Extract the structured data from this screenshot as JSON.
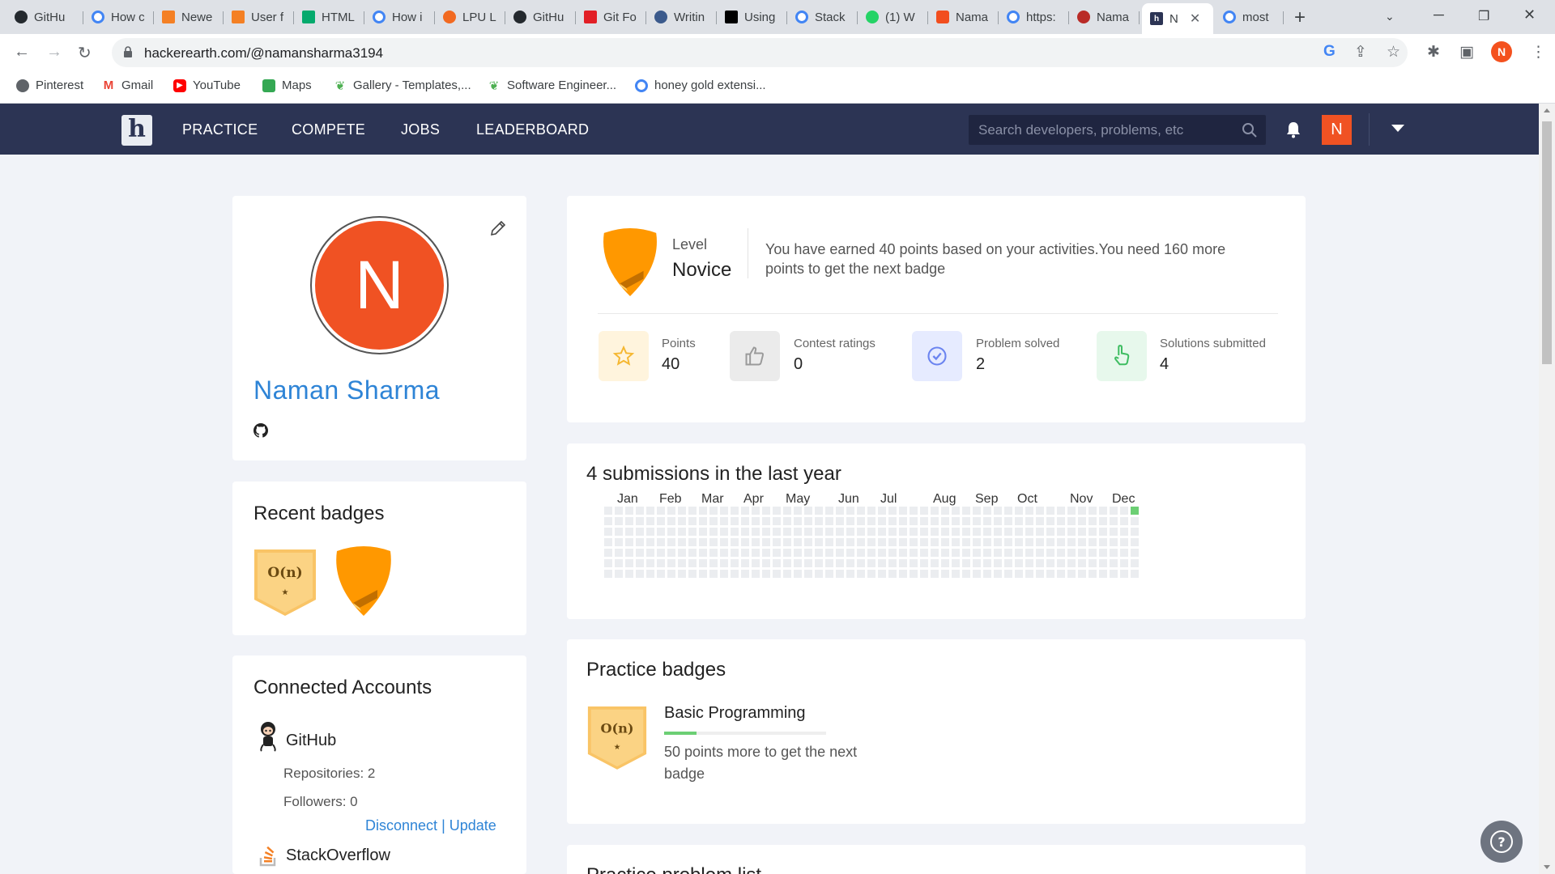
{
  "browser": {
    "tabs": [
      {
        "label": "GitHu",
        "favicon": "github-icon"
      },
      {
        "label": "How c",
        "favicon": "google-icon"
      },
      {
        "label": "Newe",
        "favicon": "stackoverflow-icon"
      },
      {
        "label": "User f",
        "favicon": "stackoverflow-icon"
      },
      {
        "label": "HTML",
        "favicon": "w3schools-icon"
      },
      {
        "label": "How i",
        "favicon": "google-icon"
      },
      {
        "label": "LPU L",
        "favicon": "lpu-icon"
      },
      {
        "label": "GitHu",
        "favicon": "github-icon"
      },
      {
        "label": "Git Fo",
        "favicon": "vercel-icon"
      },
      {
        "label": "Writin",
        "favicon": "gitbook-icon"
      },
      {
        "label": "Using",
        "favicon": "medium-icon"
      },
      {
        "label": "Stack",
        "favicon": "google-icon"
      },
      {
        "label": "(1) W",
        "favicon": "whatsapp-icon"
      },
      {
        "label": "Nama",
        "favicon": "figma-icon"
      },
      {
        "label": "https:",
        "favicon": "google-icon"
      },
      {
        "label": "Nama",
        "favicon": "quora-icon"
      },
      {
        "label": "N",
        "favicon": "hackerearth-icon",
        "active": true
      },
      {
        "label": "most",
        "favicon": "google-icon"
      }
    ],
    "url": "hackerearth.com/@namansharma3194",
    "profile_initial": "N",
    "bookmarks": [
      {
        "label": "Pinterest",
        "icon": "globe-icon"
      },
      {
        "label": "Gmail",
        "icon": "gmail-icon"
      },
      {
        "label": "YouTube",
        "icon": "youtube-icon"
      },
      {
        "label": "Maps",
        "icon": "maps-icon"
      },
      {
        "label": "Gallery - Templates,...",
        "icon": "leaf-icon"
      },
      {
        "label": "Software Engineer...",
        "icon": "leaf-icon"
      },
      {
        "label": "honey gold extensi...",
        "icon": "google-icon"
      }
    ]
  },
  "site": {
    "logo": "h",
    "nav": [
      "PRACTICE",
      "COMPETE",
      "JOBS",
      "LEADERBOARD"
    ],
    "search_placeholder": "Search developers, problems, etc",
    "user_initial": "N"
  },
  "profile": {
    "initial": "N",
    "name": "Naman Sharma"
  },
  "recent_badges": {
    "title": "Recent badges",
    "items": [
      {
        "symbol": "O(n)",
        "color": "#f9c466"
      },
      {
        "symbol": "",
        "color": "#ff9800"
      }
    ]
  },
  "connected": {
    "title": "Connected Accounts",
    "github": {
      "name": "GitHub",
      "repositories": "Repositories: 2",
      "followers": "Followers: 0",
      "disconnect": "Disconnect",
      "separator": "|",
      "update": "Update"
    },
    "stackoverflow": {
      "name": "StackOverflow"
    }
  },
  "level": {
    "label": "Level",
    "value": "Novice",
    "message": "You have earned 40 points based on your activities.You need 160 more points to get the next badge"
  },
  "stats": [
    {
      "label": "Points",
      "value": "40",
      "icon": "star-icon",
      "bg": "#fff4dd",
      "fg": "#f5b731"
    },
    {
      "label": "Contest ratings",
      "value": "0",
      "icon": "thumbs-up-icon",
      "bg": "#ebebeb",
      "fg": "#9a9a9a"
    },
    {
      "label": "Problem solved",
      "value": "2",
      "icon": "check-circle-icon",
      "bg": "#e6ebff",
      "fg": "#6b84f0"
    },
    {
      "label": "Solutions submitted",
      "value": "4",
      "icon": "pointer-hand-icon",
      "bg": "#e7f8ec",
      "fg": "#3fbd62"
    }
  ],
  "submissions": {
    "title": "4 submissions in the last year",
    "months": [
      "Jan",
      "Feb",
      "Mar",
      "Apr",
      "May",
      "Jun",
      "Jul",
      "Aug",
      "Sep",
      "Oct",
      "Nov",
      "Dec"
    ],
    "active_cells": [
      {
        "week": 50,
        "day": 0,
        "color": "#6ccf74"
      }
    ]
  },
  "practice_badges": {
    "title": "Practice badges",
    "items": [
      {
        "symbol": "O(n)",
        "name": "Basic Programming",
        "note": "50 points more to get the next badge",
        "progress": 0.2
      }
    ]
  },
  "next_section_title": "Practice problem list",
  "colors": {
    "header": "#2c3454",
    "accent": "#f05223",
    "link": "#2e84d6",
    "badge_gold": "#f9c466",
    "badge_orange": "#ff9800"
  }
}
